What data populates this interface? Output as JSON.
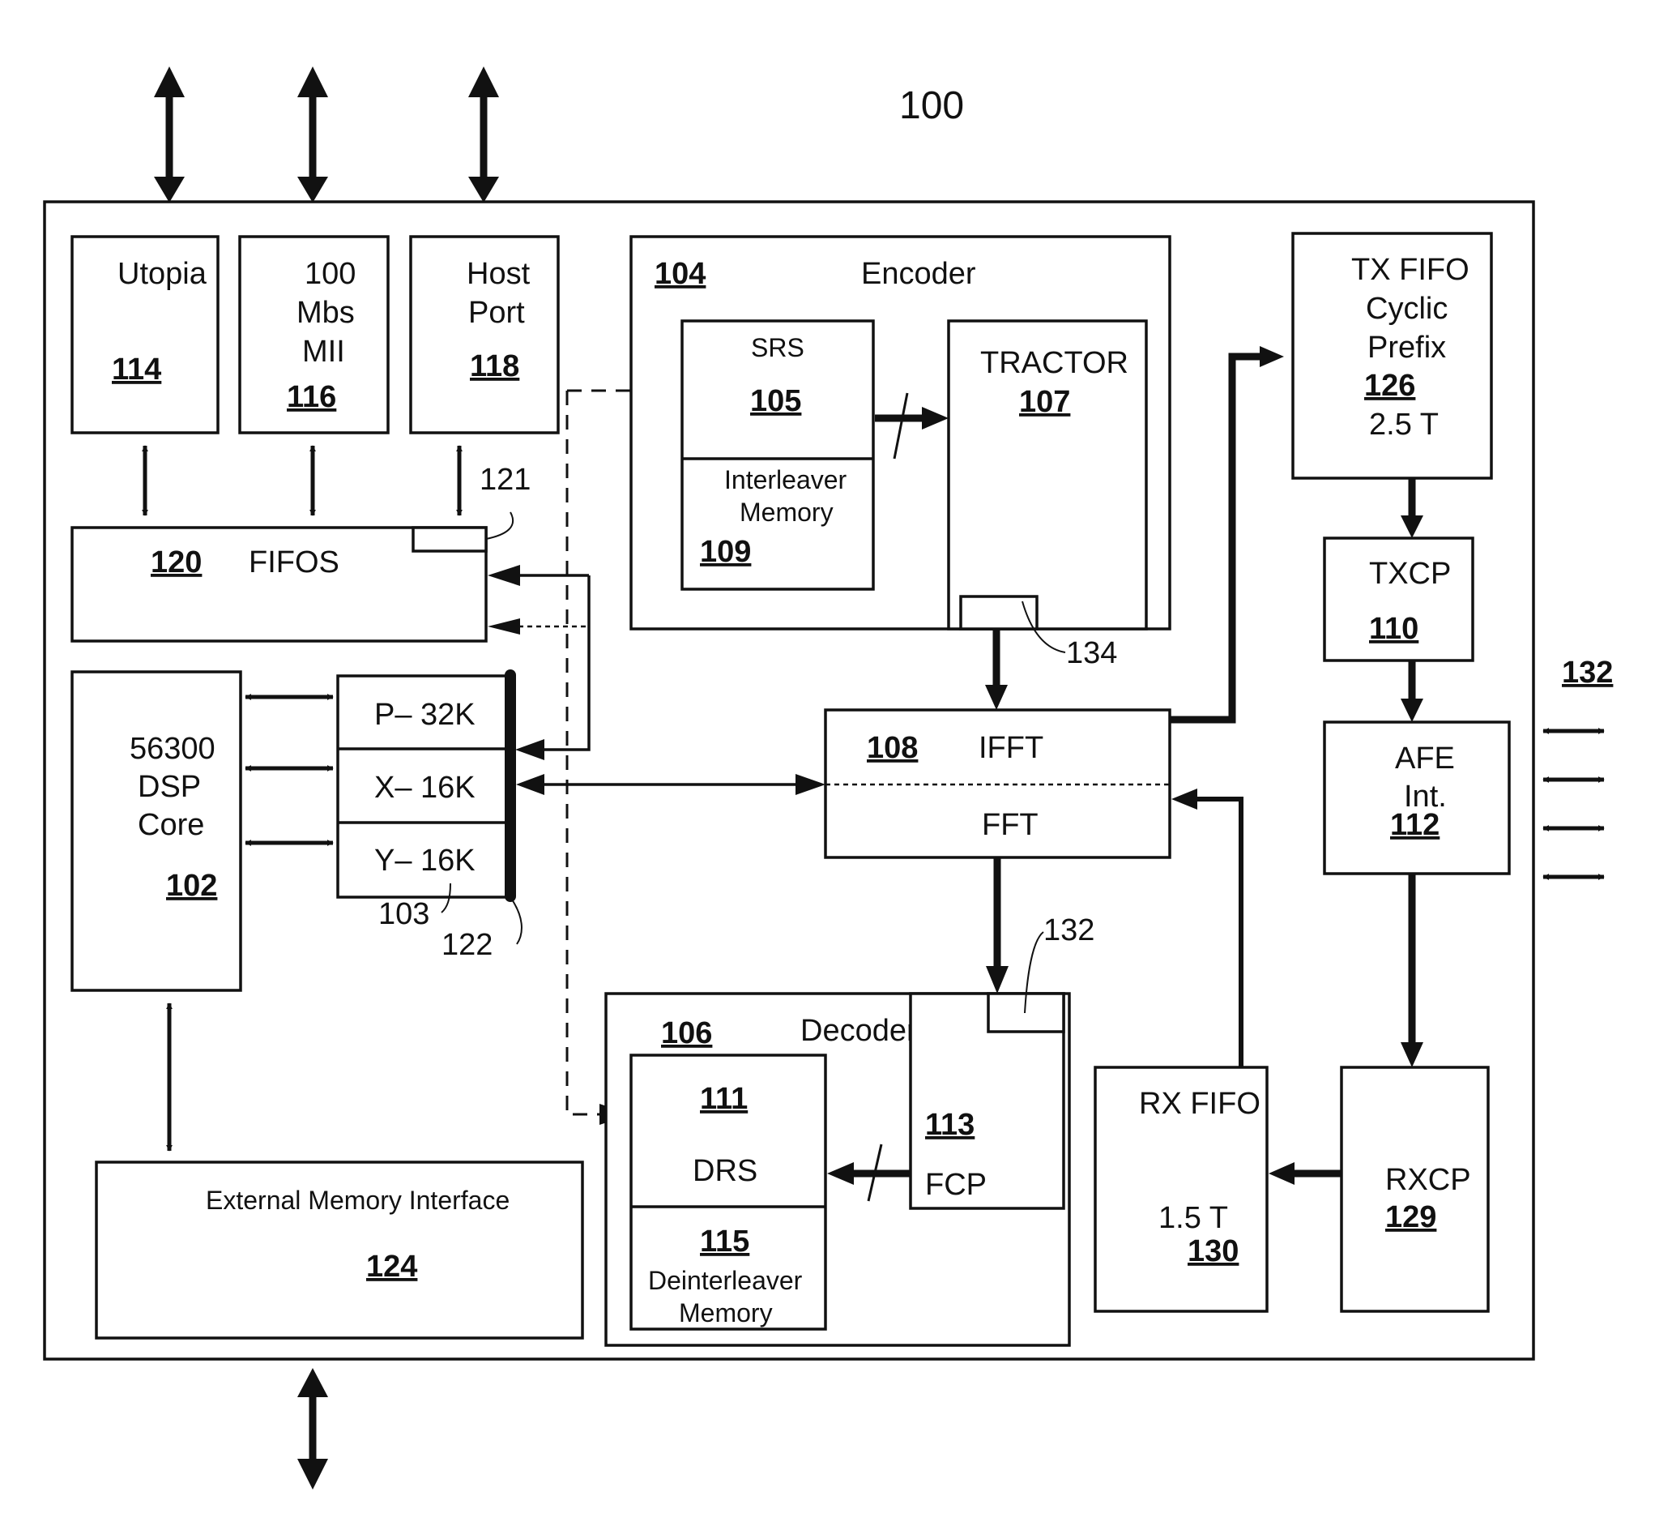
{
  "figure": {
    "ref": "100",
    "external_ref": "132"
  },
  "blocks": {
    "utopia": {
      "label": "Utopia",
      "ref": "114"
    },
    "mii": {
      "line1": "100",
      "line2": "Mbs",
      "line3": "MII",
      "ref": "116"
    },
    "host_port": {
      "line1": "Host",
      "line2": "Port",
      "ref": "118"
    },
    "fifos": {
      "label": "FIFOS",
      "ref": "120",
      "sub_ref": "121"
    },
    "encoder": {
      "label": "Encoder",
      "ref": "104"
    },
    "srs": {
      "label": "SRS",
      "ref": "105"
    },
    "interleaver": {
      "line1": "Interleaver",
      "line2": "Memory",
      "ref": "109"
    },
    "tractor": {
      "label": "TRACTOR",
      "ref": "107",
      "sub_ref": "134"
    },
    "tx_fifo": {
      "line1": "TX FIFO",
      "line2": "Cyclic",
      "line3": "Prefix",
      "ref": "126",
      "value": "2.5 T"
    },
    "txcp": {
      "label": "TXCP",
      "ref": "110"
    },
    "afe": {
      "line1": "AFE",
      "line2": "Int.",
      "ref": "112"
    },
    "dsp": {
      "line1": "56300",
      "line2": "DSP",
      "line3": "Core",
      "ref": "102"
    },
    "memory": {
      "p": "P– 32K",
      "x": "X– 16K",
      "y": "Y– 16K",
      "ref": "103",
      "bus_ref": "122"
    },
    "ifft_fft": {
      "top": "IFFT",
      "bottom": "FFT",
      "ref": "108"
    },
    "decoder": {
      "label": "Decoder",
      "ref": "106"
    },
    "drs": {
      "label": "DRS",
      "ref": "111"
    },
    "deinterleaver": {
      "line1": "Deinterleaver",
      "line2": "Memory",
      "ref": "115"
    },
    "fcp": {
      "label": "FCP",
      "ref": "113",
      "sub_ref": "132"
    },
    "rx_fifo": {
      "label": "RX FIFO",
      "value": "1.5 T",
      "ref": "130"
    },
    "rxcp": {
      "label": "RXCP",
      "ref": "129"
    },
    "ext_mem": {
      "label": "External Memory Interface",
      "ref": "124"
    }
  }
}
